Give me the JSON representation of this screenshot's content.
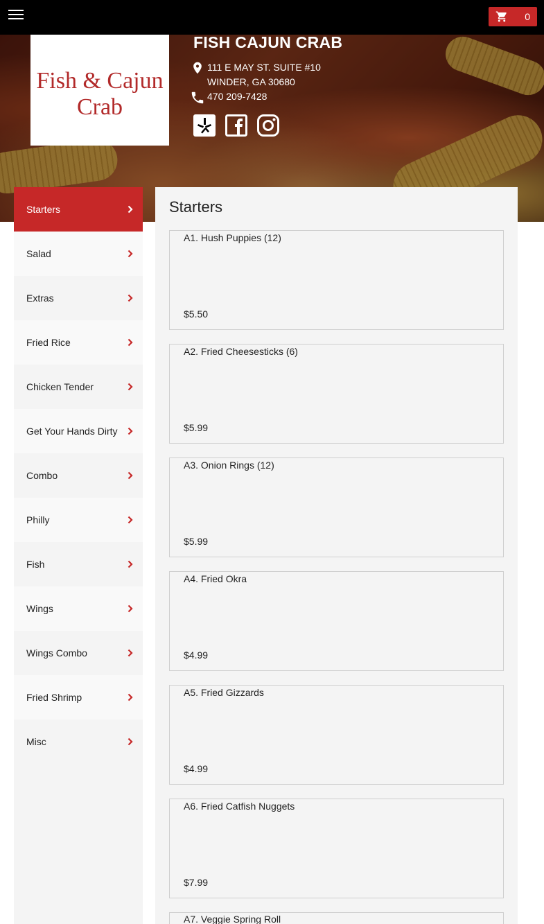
{
  "header": {
    "cart_count": "0"
  },
  "restaurant": {
    "logo_line1": "Fish & Cajun",
    "logo_line2": "Crab",
    "name": "FISH CAJUN CRAB",
    "address_line1": "111 E MAY ST. SUITE #10",
    "address_line2": "WINDER, GA 30680",
    "phone": "470 209-7428",
    "social_icons": [
      "yelp-icon",
      "facebook-icon",
      "instagram-icon"
    ]
  },
  "sidebar": {
    "categories": [
      {
        "label": "Starters",
        "active": true
      },
      {
        "label": "Salad"
      },
      {
        "label": "Extras"
      },
      {
        "label": "Fried Rice"
      },
      {
        "label": "Chicken Tender"
      },
      {
        "label": "Get Your Hands Dirty"
      },
      {
        "label": "Combo"
      },
      {
        "label": "Philly"
      },
      {
        "label": "Fish"
      },
      {
        "label": "Wings"
      },
      {
        "label": "Wings Combo"
      },
      {
        "label": "Fried Shrimp"
      },
      {
        "label": "Misc"
      }
    ]
  },
  "main": {
    "section_title": "Starters",
    "items": [
      {
        "name": "A1. Hush Puppies (12)",
        "price": "$5.50"
      },
      {
        "name": "A2. Fried Cheesesticks (6)",
        "price": "$5.99"
      },
      {
        "name": "A3. Onion Rings (12)",
        "price": "$5.99"
      },
      {
        "name": "A4. Fried Okra",
        "price": "$4.99"
      },
      {
        "name": "A5. Fried Gizzards",
        "price": "$4.99"
      },
      {
        "name": "A6. Fried Catfish Nuggets",
        "price": "$7.99"
      },
      {
        "name": "A7. Veggie Spring Roll",
        "price": ""
      }
    ]
  },
  "colors": {
    "accent": "#c62828",
    "topbar": "#000000",
    "panel": "#f4f4f4"
  }
}
